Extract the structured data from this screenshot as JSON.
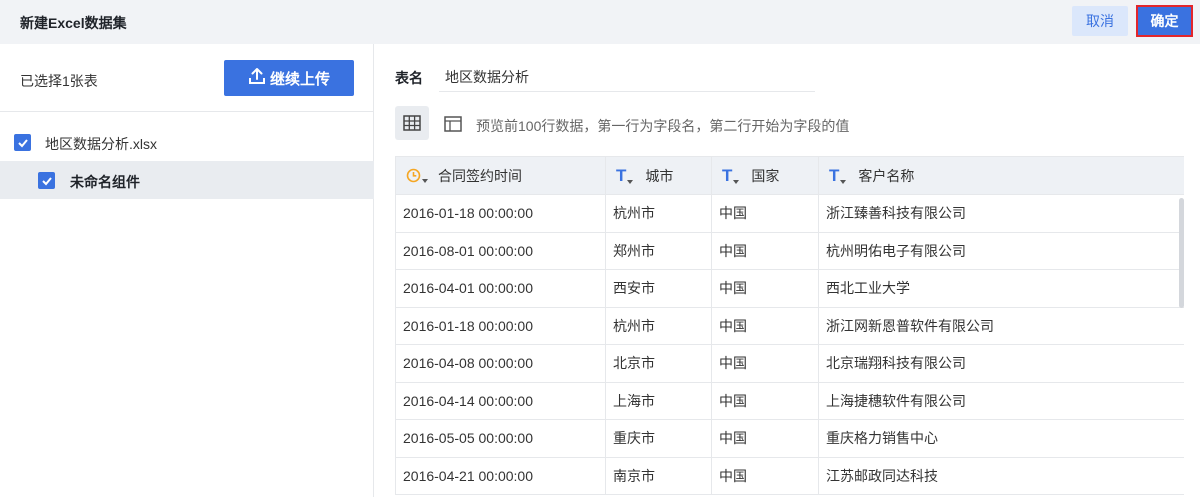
{
  "header": {
    "title": "新建Excel数据集",
    "cancel_label": "取消",
    "confirm_label": "确定"
  },
  "left_panel": {
    "selected_count": "已选择1张表",
    "upload_label": "继续上传",
    "file": {
      "name": "地区数据分析.xlsx",
      "checked": true
    },
    "sheet": {
      "name": "未命名组件",
      "checked": true
    }
  },
  "right_panel": {
    "table_name_label": "表名",
    "table_name_value": "地区数据分析",
    "preview_hint": "预览前100行数据，第一行为字段名，第二行开始为字段的值"
  },
  "table": {
    "columns": [
      {
        "name": "合同签约时间",
        "type_icon": "clock-icon"
      },
      {
        "name": "城市",
        "type_icon": "text-type-icon"
      },
      {
        "name": "国家",
        "type_icon": "text-type-icon"
      },
      {
        "name": "客户名称",
        "type_icon": "text-type-icon"
      }
    ],
    "rows": [
      [
        "2016-01-18 00:00:00",
        "杭州市",
        "中国",
        "浙江臻善科技有限公司"
      ],
      [
        "2016-08-01 00:00:00",
        "郑州市",
        "中国",
        "杭州明佑电子有限公司"
      ],
      [
        "2016-04-01 00:00:00",
        "西安市",
        "中国",
        "西北工业大学"
      ],
      [
        "2016-01-18 00:00:00",
        "杭州市",
        "中国",
        "浙江网新恩普软件有限公司"
      ],
      [
        "2016-04-08 00:00:00",
        "北京市",
        "中国",
        "北京瑞翔科技有限公司"
      ],
      [
        "2016-04-14 00:00:00",
        "上海市",
        "中国",
        "上海捷穗软件有限公司"
      ],
      [
        "2016-05-05 00:00:00",
        "重庆市",
        "中国",
        "重庆格力销售中心"
      ],
      [
        "2016-04-21 00:00:00",
        "南京市",
        "中国",
        "江苏邮政同达科技"
      ]
    ]
  },
  "colors": {
    "primary": "#3a72e0",
    "header_bg": "#f1f3f6",
    "selected_row_bg": "#e9ecf0",
    "clock_icon": "#f5a623",
    "confirm_border": "#e3262b"
  }
}
